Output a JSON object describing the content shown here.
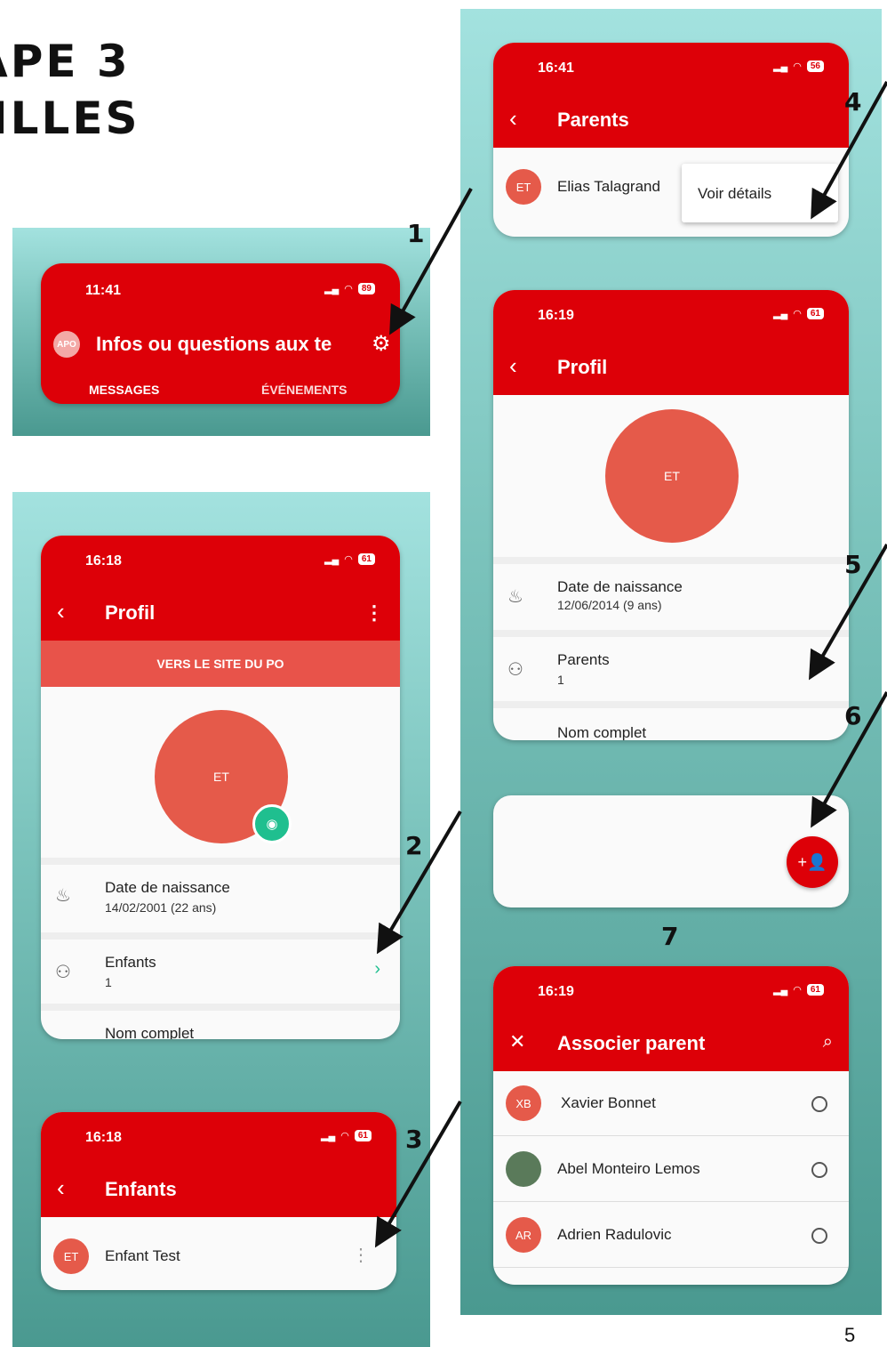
{
  "page": {
    "title_line1": "APE 3",
    "title_line2": "ILLES",
    "page_number": "5"
  },
  "steps": [
    "1",
    "2",
    "3",
    "4",
    "5",
    "6",
    "7"
  ],
  "screen_home": {
    "time": "11:41",
    "battery": "89",
    "logo_text": "APO",
    "title": "Infos ou questions aux te",
    "tabs": [
      "MESSAGES",
      "ÉVÉNEMENTS"
    ],
    "settings_icon": "gear-icon"
  },
  "screen_profil_parent": {
    "time": "16:18",
    "battery": "61",
    "title": "Profil",
    "banner": "VERS LE SITE DU PO",
    "avatar": "ET",
    "birth_label": "Date de naissance",
    "birth_value": "14/02/2001 (22 ans)",
    "children_label": "Enfants",
    "children_value": "1",
    "name_label": "Nom complet"
  },
  "screen_enfants": {
    "time": "16:18",
    "battery": "61",
    "title": "Enfants",
    "child_initials": "ET",
    "child_name": "Enfant Test"
  },
  "screen_parents": {
    "time": "16:41",
    "battery": "56",
    "title": "Parents",
    "parent_initials": "ET",
    "parent_name": "Elias Talagrand",
    "menu_item": "Voir détails"
  },
  "screen_profil_child": {
    "time": "16:19",
    "battery": "61",
    "title": "Profil",
    "avatar": "ET",
    "birth_label": "Date de naissance",
    "birth_value": "12/06/2014 (9 ans)",
    "parents_label": "Parents",
    "parents_value": "1",
    "name_label": "Nom complet"
  },
  "screen_associer": {
    "time": "16:19",
    "battery": "61",
    "title": "Associer parent",
    "people": [
      {
        "initials": "XB",
        "name": "Xavier Bonnet"
      },
      {
        "initials": "",
        "name": "Abel Monteiro Lemos"
      },
      {
        "initials": "AR",
        "name": "Adrien Radulovic"
      }
    ]
  },
  "colors": {
    "header_red": "#dd0008",
    "avatar_red": "#e55a4a",
    "teal_accent": "#1fbf8f",
    "banner_red": "#e8534a"
  }
}
